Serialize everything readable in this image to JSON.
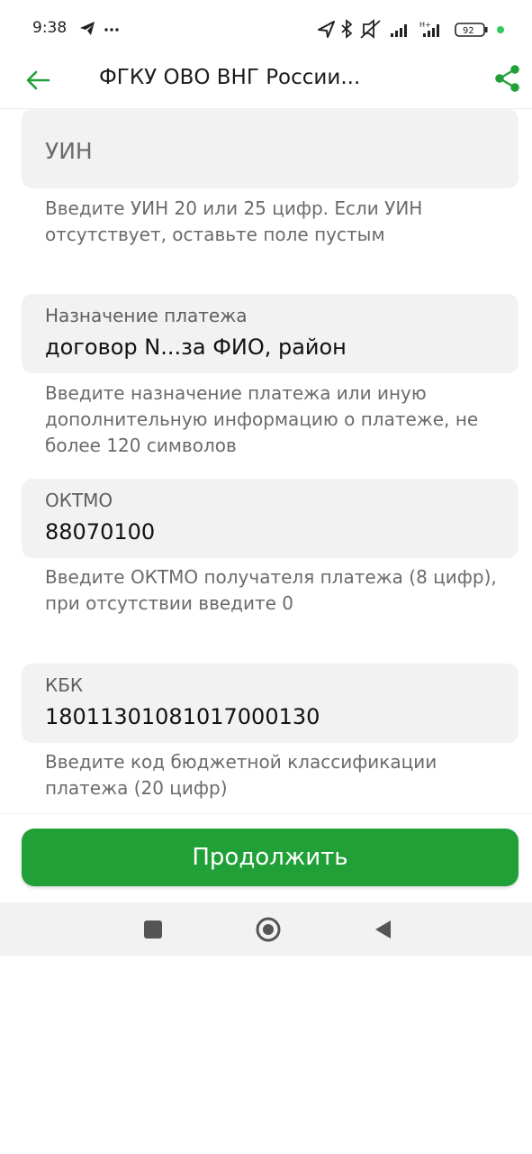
{
  "status_bar": {
    "time": "9:38",
    "battery": "92",
    "icons": [
      "telegram-icon",
      "more-icon",
      "location-icon",
      "bluetooth-icon",
      "mute-icon",
      "signal-icon",
      "signal-h-plus-icon",
      "battery-icon",
      "dot-indicator"
    ]
  },
  "header": {
    "title": "ФГКУ ОВО ВНГ России...",
    "accent_color": "#21a038"
  },
  "form": {
    "uin": {
      "placeholder": "УИН",
      "hint": "Введите УИН 20 или 25 цифр. Если УИН отсутствует, оставьте поле пустым"
    },
    "purpose": {
      "label": "Назначение платежа",
      "value": "договор N...за ФИО, район",
      "hint": "Введите назначение платежа или иную дополнительную информацию о платеже, не более 120 символов"
    },
    "oktmo": {
      "label": "ОКТМО",
      "value": "88070100",
      "hint": "Введите ОКТМО получателя платежа (8 цифр), при отсутствии введите 0"
    },
    "kbk": {
      "label": "КБК",
      "value": "18011301081017000130",
      "hint": "Введите код бюджетной классификации платежа (20 цифр)"
    }
  },
  "continue_button": {
    "label": "Продолжить",
    "color": "#21a038"
  },
  "nav_bar": {
    "buttons": [
      "recents-square-icon",
      "home-circle-icon",
      "back-triangle-icon"
    ]
  }
}
